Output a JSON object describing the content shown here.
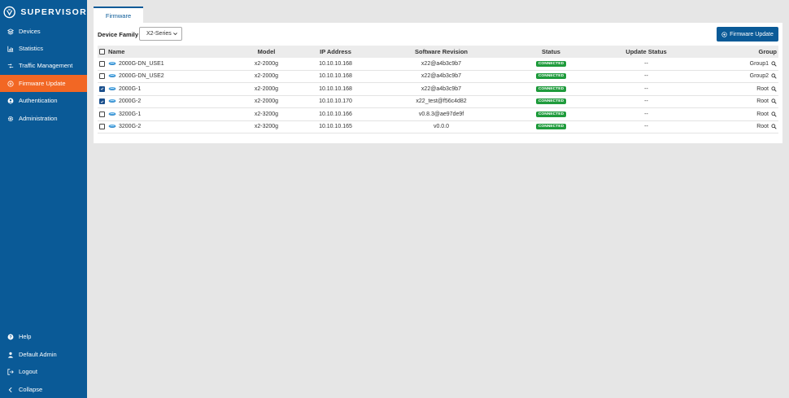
{
  "brand": {
    "name": "SUPERVISOR"
  },
  "sidebar": {
    "items": [
      {
        "label": "Devices",
        "icon": "layers-icon"
      },
      {
        "label": "Statistics",
        "icon": "chart-icon"
      },
      {
        "label": "Traffic Management",
        "icon": "traffic-icon"
      },
      {
        "label": "Firmware Update",
        "icon": "firmware-icon",
        "active": true
      },
      {
        "label": "Authentication",
        "icon": "user-icon"
      },
      {
        "label": "Administration",
        "icon": "gear-icon"
      }
    ],
    "bottom": [
      {
        "label": "Help",
        "icon": "help-icon"
      },
      {
        "label": "Default Admin",
        "icon": "user-icon"
      },
      {
        "label": "Logout",
        "icon": "logout-icon"
      },
      {
        "label": "Collapse",
        "icon": "chevron-left-icon"
      }
    ]
  },
  "tabs": [
    {
      "label": "Firmware"
    }
  ],
  "filter": {
    "label": "Device Family",
    "value": "X2-Series"
  },
  "actions": {
    "firmware_update": "Firmware Update"
  },
  "table": {
    "headers": [
      "Name",
      "Model",
      "IP Address",
      "Software Revision",
      "Status",
      "Update Status",
      "Group"
    ],
    "rows": [
      {
        "checked": false,
        "name": "2000G-DN_USE1",
        "model": "x2-2000g",
        "ip": "10.10.10.168",
        "software": "x22@a4b3c9b7",
        "status": "CONNECTED",
        "update": "--",
        "group": "Group1"
      },
      {
        "checked": false,
        "name": "2000G-DN_USE2",
        "model": "x2-2000g",
        "ip": "10.10.10.168",
        "software": "x22@a4b3c9b7",
        "status": "CONNECTED",
        "update": "--",
        "group": "Group2"
      },
      {
        "checked": true,
        "name": "2000G-1",
        "model": "x2-2000g",
        "ip": "10.10.10.168",
        "software": "x22@a4b3c9b7",
        "status": "CONNECTED",
        "update": "--",
        "group": "Root"
      },
      {
        "checked": true,
        "name": "2000G-2",
        "model": "x2-2000g",
        "ip": "10.10.10.170",
        "software": "x22_test@f56c4d82",
        "status": "CONNECTED",
        "update": "--",
        "group": "Root"
      },
      {
        "checked": false,
        "name": "3200G-1",
        "model": "x2-3200g",
        "ip": "10.10.10.166",
        "software": "v0.8.3@ae97de9f",
        "status": "CONNECTED",
        "update": "--",
        "group": "Root"
      },
      {
        "checked": false,
        "name": "3200G-2",
        "model": "x2-3200g",
        "ip": "10.10.10.165",
        "software": "v0.0.0",
        "status": "CONNECTED",
        "update": "--",
        "group": "Root"
      }
    ]
  },
  "colors": {
    "sidebar": "#0a5a97",
    "active": "#f26724",
    "connected": "#1f9b3c"
  }
}
